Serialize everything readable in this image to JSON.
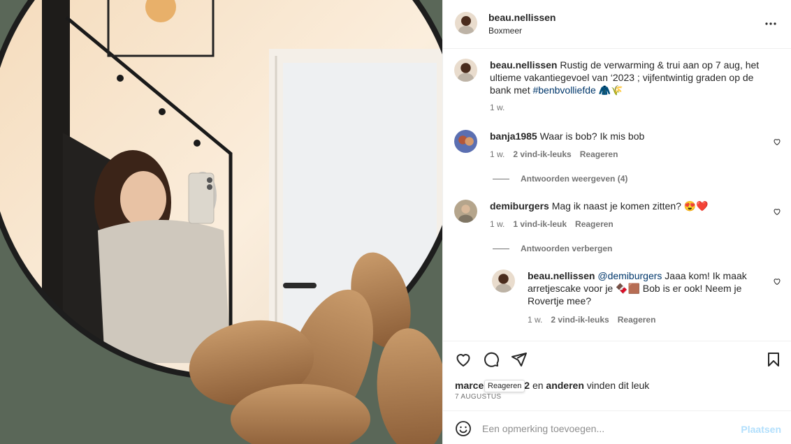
{
  "post": {
    "username": "beau.nellissen",
    "location": "Boxmeer"
  },
  "caption": {
    "username": "beau.nellissen",
    "text": "Rustig de verwarming & trui aan op 7 aug, het ultieme vakantiegevoel van ‘2023 ; vijfentwintig graden op de bank met ",
    "hashtag": "#benbvolliefde",
    "emoji": "🧥🌾",
    "age": "1 w."
  },
  "comments": [
    {
      "username": "banja1985",
      "text": "Waar is bob? Ik mis bob",
      "age": "1 w.",
      "likes": "2 vind-ik-leuks",
      "reply": "Reageren",
      "replies_toggle": "Antwoorden weergeven (4)"
    },
    {
      "username": "demiburgers",
      "text": "Mag ik naast je komen zitten? 😍❤️",
      "age": "1 w.",
      "likes": "1 vind-ik-leuk",
      "reply": "Reageren",
      "replies_toggle": "Antwoorden verbergen"
    }
  ],
  "reply": {
    "username": "beau.nellissen",
    "mention": "@demiburgers",
    "text": " Jaaa kom! Ik maak arretjescake voor je 🍫🟫 Bob is er ook! Neem je Rovertje mee?",
    "age": "1 w.",
    "likes": "2 vind-ik-leuks",
    "reply": "Reageren"
  },
  "likes_line": {
    "user_visible": "marce",
    "user_tail": "2",
    "connector": " en ",
    "others": "anderen",
    "suffix": " vinden dit leuk"
  },
  "date": "7 AUGUSTUS",
  "tooltip": "Reageren",
  "composer": {
    "placeholder": "Een opmerking toevoegen...",
    "post_label": "Plaatsen"
  },
  "icons": {
    "more": "more-horizontal-icon",
    "like": "heart-icon",
    "comment": "comment-icon",
    "share": "paper-plane-icon",
    "save": "bookmark-icon",
    "emoji": "emoji-smile-icon"
  },
  "colors": {
    "link": "#00376b",
    "muted": "#737373",
    "post_button": "#b2dffc"
  }
}
